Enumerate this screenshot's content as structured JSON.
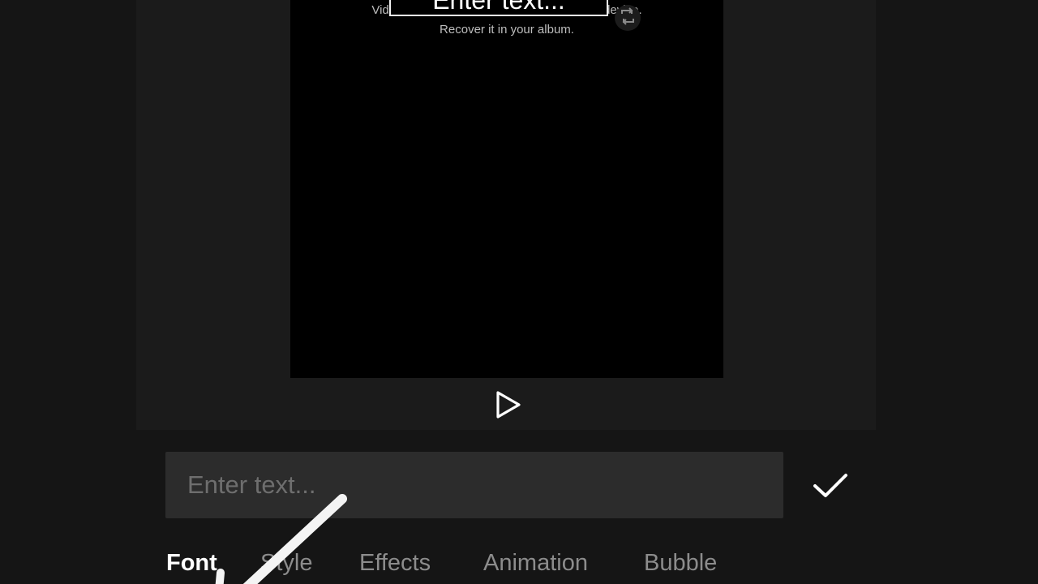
{
  "preview": {
    "overlay_text": "Enter text...",
    "missing_media_line1": "Video or photo is deleted or moved in your device.",
    "missing_media_line2": "Recover it in your album."
  },
  "icons": {
    "rotate": "rotate-handle-icon",
    "play": "play-icon",
    "confirm": "checkmark-icon"
  },
  "text_input": {
    "placeholder": "Enter text...",
    "value": ""
  },
  "tabs": [
    {
      "label": "Font",
      "active": true
    },
    {
      "label": "Style",
      "active": false
    },
    {
      "label": "Effects",
      "active": false
    },
    {
      "label": "Animation",
      "active": false
    },
    {
      "label": "Bubble",
      "active": false
    }
  ],
  "colors": {
    "background": "#151515",
    "preview": "#000000",
    "input_bg": "#2c2c2c",
    "tab_active": "#ffffff",
    "tab_inactive": "#8c8c8c"
  }
}
